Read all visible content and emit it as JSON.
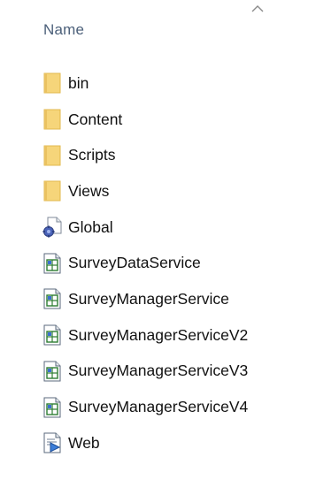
{
  "header": {
    "name_label": "Name",
    "sort_direction": "ascending"
  },
  "colors": {
    "folder": "#f6d57a",
    "header_text": "#4c607a",
    "item_text": "#111111"
  },
  "files": [
    {
      "name": "bin",
      "icon": "folder-icon"
    },
    {
      "name": "Content",
      "icon": "folder-icon"
    },
    {
      "name": "Scripts",
      "icon": "folder-icon"
    },
    {
      "name": "Views",
      "icon": "folder-icon"
    },
    {
      "name": "Global",
      "icon": "asax-file-icon"
    },
    {
      "name": "SurveyDataService",
      "icon": "service-file-icon"
    },
    {
      "name": "SurveyManagerService",
      "icon": "service-file-icon"
    },
    {
      "name": "SurveyManagerServiceV2",
      "icon": "service-file-icon"
    },
    {
      "name": "SurveyManagerServiceV3",
      "icon": "service-file-icon"
    },
    {
      "name": "SurveyManagerServiceV4",
      "icon": "service-file-icon"
    },
    {
      "name": "Web",
      "icon": "config-file-icon"
    }
  ]
}
